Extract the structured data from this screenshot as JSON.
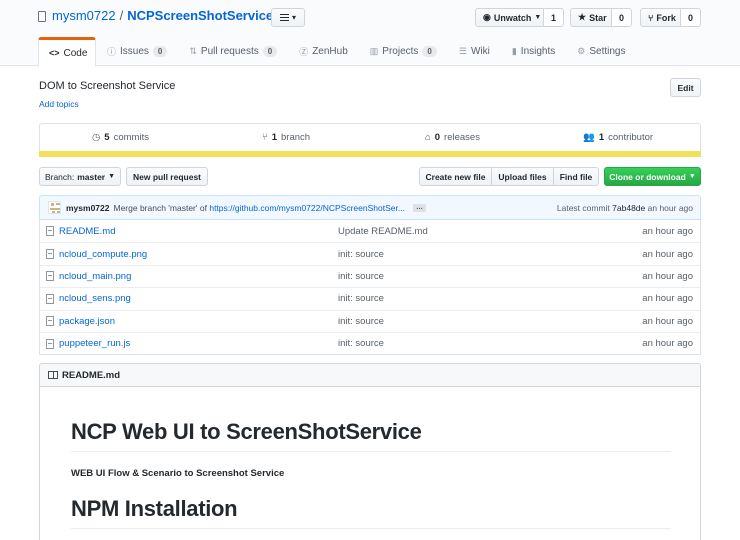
{
  "repo": {
    "owner": "mysm0722",
    "separator": "/",
    "name": "NCPScreenShotService"
  },
  "social": {
    "watch": {
      "label": "Unwatch",
      "count": "1"
    },
    "star": {
      "label": "Star",
      "count": "0"
    },
    "fork": {
      "label": "Fork",
      "count": "0"
    }
  },
  "tabs": [
    {
      "label": "Code",
      "icon": "code-icon"
    },
    {
      "label": "Issues",
      "count": "0",
      "icon": "issue-icon"
    },
    {
      "label": "Pull requests",
      "count": "0",
      "icon": "pull-request-icon"
    },
    {
      "label": "ZenHub",
      "icon": "zenhub-icon"
    },
    {
      "label": "Projects",
      "count": "0",
      "icon": "project-icon"
    },
    {
      "label": "Wiki",
      "icon": "wiki-icon"
    },
    {
      "label": "Insights",
      "icon": "graph-icon"
    },
    {
      "label": "Settings",
      "icon": "gear-icon"
    }
  ],
  "description": "DOM to Screenshot Service",
  "edit_label": "Edit",
  "add_topics": "Add topics",
  "stats": {
    "commits": {
      "num": "5",
      "label": "commits"
    },
    "branches": {
      "num": "1",
      "label": "branch"
    },
    "releases": {
      "num": "0",
      "label": "releases"
    },
    "contributors": {
      "num": "1",
      "label": "contributor"
    }
  },
  "language_color": "#f1e05a",
  "file_nav": {
    "branch_prefix": "Branch:",
    "branch": "master",
    "new_pr": "New pull request",
    "create_file": "Create new file",
    "upload": "Upload files",
    "find": "Find file",
    "clone": "Clone or download"
  },
  "commit": {
    "author": "mysm0722",
    "message": "Merge branch 'master' of",
    "link": "https://github.com/mysm0722/NCPScreenShotSer...",
    "ellipsis": "…",
    "latest_prefix": "Latest commit",
    "sha": "7ab48de",
    "age": "an hour ago"
  },
  "files": [
    {
      "name": "README.md",
      "message": "Update README.md",
      "age": "an hour ago"
    },
    {
      "name": "ncloud_compute.png",
      "message": "init: source",
      "age": "an hour ago"
    },
    {
      "name": "ncloud_main.png",
      "message": "init: source",
      "age": "an hour ago"
    },
    {
      "name": "ncloud_sens.png",
      "message": "init: source",
      "age": "an hour ago"
    },
    {
      "name": "package.json",
      "message": "init: source",
      "age": "an hour ago"
    },
    {
      "name": "puppeteer_run.js",
      "message": "init: source",
      "age": "an hour ago"
    }
  ],
  "readme": {
    "header": "README.md",
    "h1": "NCP Web UI to ScreenShotService",
    "h4": "WEB UI Flow & Scenario to Screenshot Service",
    "h1_2": "NPM Installation"
  },
  "colors": {
    "link": "#0366d6",
    "tab_accent": "#e36209",
    "clone_button": "#28a745"
  }
}
